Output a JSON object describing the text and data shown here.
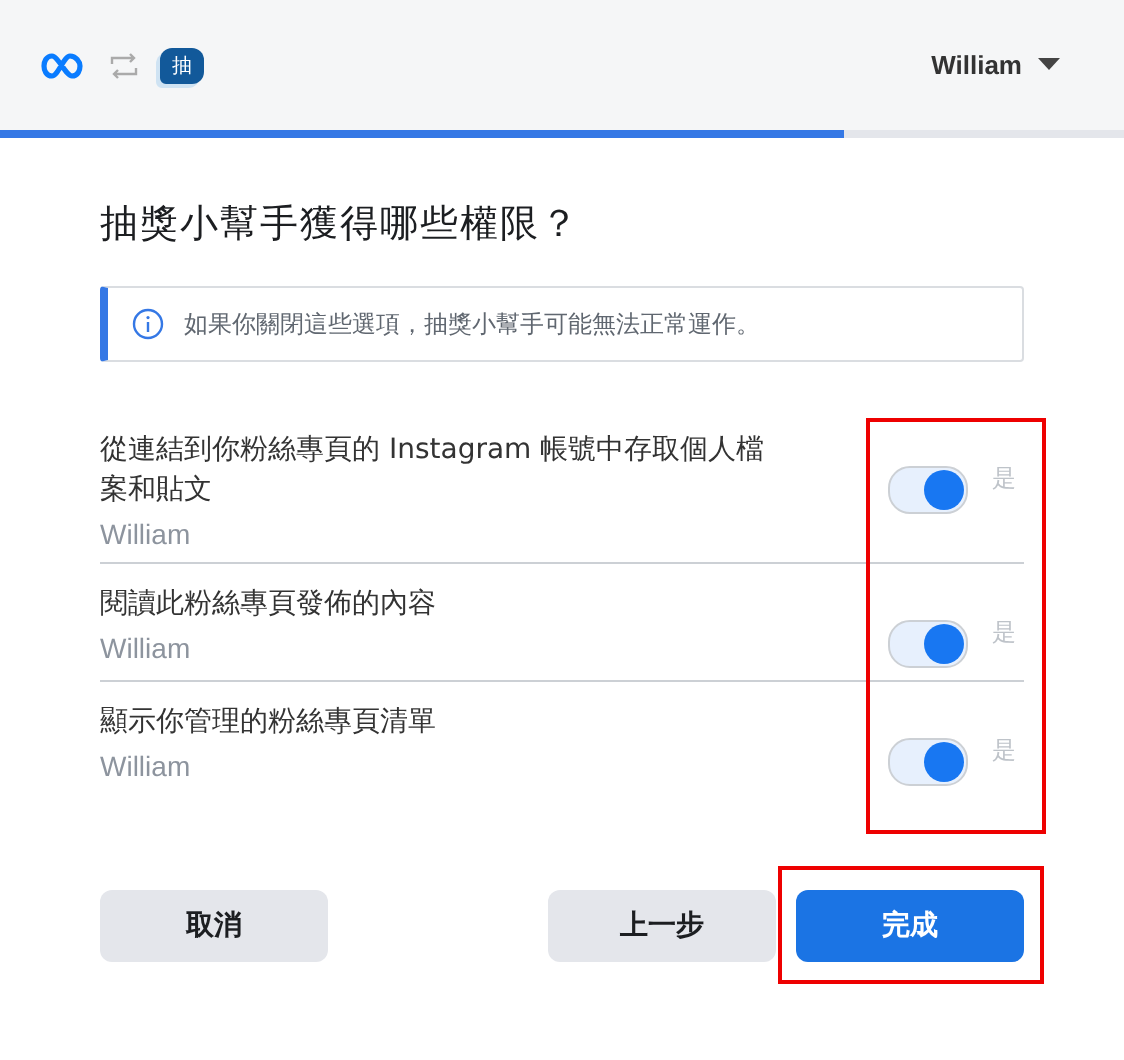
{
  "header": {
    "app_badge": "抽",
    "user": "William"
  },
  "progress": {
    "level": 0.75
  },
  "title": "抽獎小幫手獲得哪些權限？",
  "notice": "如果你關閉這些選項，抽獎小幫手可能無法正常運作。",
  "permissions": {
    "highlighted": true,
    "items": [
      {
        "label": "從連結到你粉絲專頁的 Instagram 帳號中存取個人檔案和貼文",
        "account": "William",
        "on": true,
        "state_label": "是"
      },
      {
        "label": "閱讀此粉絲專頁發佈的內容",
        "account": "William",
        "on": true,
        "state_label": "是"
      },
      {
        "label": "顯示你管理的粉絲專頁清單",
        "account": "William",
        "on": true,
        "state_label": "是"
      }
    ]
  },
  "buttons": [
    {
      "label": "取消",
      "kind": "secondary",
      "highlighted": false
    },
    {
      "label": "上一步",
      "kind": "secondary",
      "highlighted": false
    },
    {
      "label": "完成",
      "kind": "primary",
      "highlighted": true
    }
  ]
}
